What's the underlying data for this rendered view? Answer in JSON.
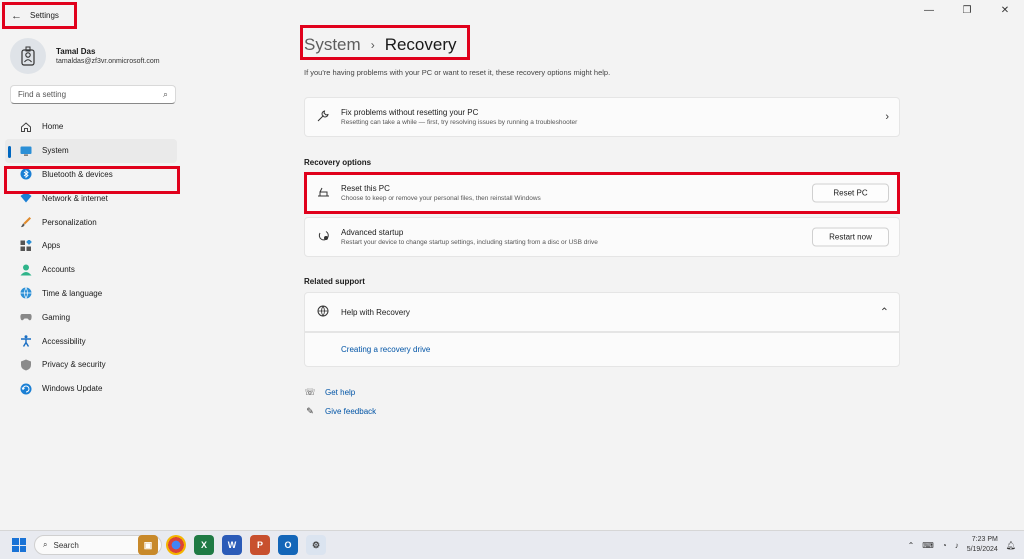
{
  "window": {
    "title": "Settings",
    "back": "←",
    "minimize": "—",
    "maximize": "❐",
    "close": "✕"
  },
  "profile": {
    "name": "Tamal Das",
    "email": "tamaldas@zf3vr.onmicrosoft.com"
  },
  "search": {
    "placeholder": "Find a setting"
  },
  "nav": [
    {
      "label": "Home",
      "icon": "home-icon"
    },
    {
      "label": "System",
      "icon": "system-icon",
      "active": true
    },
    {
      "label": "Bluetooth & devices",
      "icon": "bluetooth-icon"
    },
    {
      "label": "Network & internet",
      "icon": "network-icon"
    },
    {
      "label": "Personalization",
      "icon": "brush-icon"
    },
    {
      "label": "Apps",
      "icon": "apps-icon"
    },
    {
      "label": "Accounts",
      "icon": "accounts-icon"
    },
    {
      "label": "Time & language",
      "icon": "globe-icon"
    },
    {
      "label": "Gaming",
      "icon": "gamepad-icon"
    },
    {
      "label": "Accessibility",
      "icon": "accessibility-icon"
    },
    {
      "label": "Privacy & security",
      "icon": "shield-icon"
    },
    {
      "label": "Windows Update",
      "icon": "update-icon"
    }
  ],
  "breadcrumb": {
    "parent": "System",
    "separator": "›",
    "current": "Recovery"
  },
  "description": "If you're having problems with your PC or want to reset it, these recovery options might help.",
  "fix_card": {
    "title": "Fix problems without resetting your PC",
    "subtitle": "Resetting can take a while — first, try resolving issues by running a troubleshooter",
    "chevron": "›"
  },
  "recovery_options": {
    "heading": "Recovery options",
    "reset": {
      "title": "Reset this PC",
      "subtitle": "Choose to keep or remove your personal files, then reinstall Windows",
      "button": "Reset PC"
    },
    "advanced": {
      "title": "Advanced startup",
      "subtitle": "Restart your device to change startup settings, including starting from a disc or USB drive",
      "button": "Restart now"
    }
  },
  "related_support": {
    "heading": "Related support",
    "help": {
      "title": "Help with Recovery",
      "chevron": "⌃",
      "link": "Creating a recovery drive"
    }
  },
  "footer": {
    "get_help": "Get help",
    "give_feedback": "Give feedback"
  },
  "taskbar": {
    "search_placeholder": "Search",
    "time": "7:23 PM",
    "date": "5/19/2024",
    "apps": [
      "briefcase-app",
      "chrome-app",
      "excel-app",
      "word-app",
      "powerpoint-app",
      "outlook-app",
      "settings-app"
    ]
  },
  "colors": {
    "accent": "#0067c0",
    "highlight": "#e0001b",
    "link": "#0054a6"
  }
}
